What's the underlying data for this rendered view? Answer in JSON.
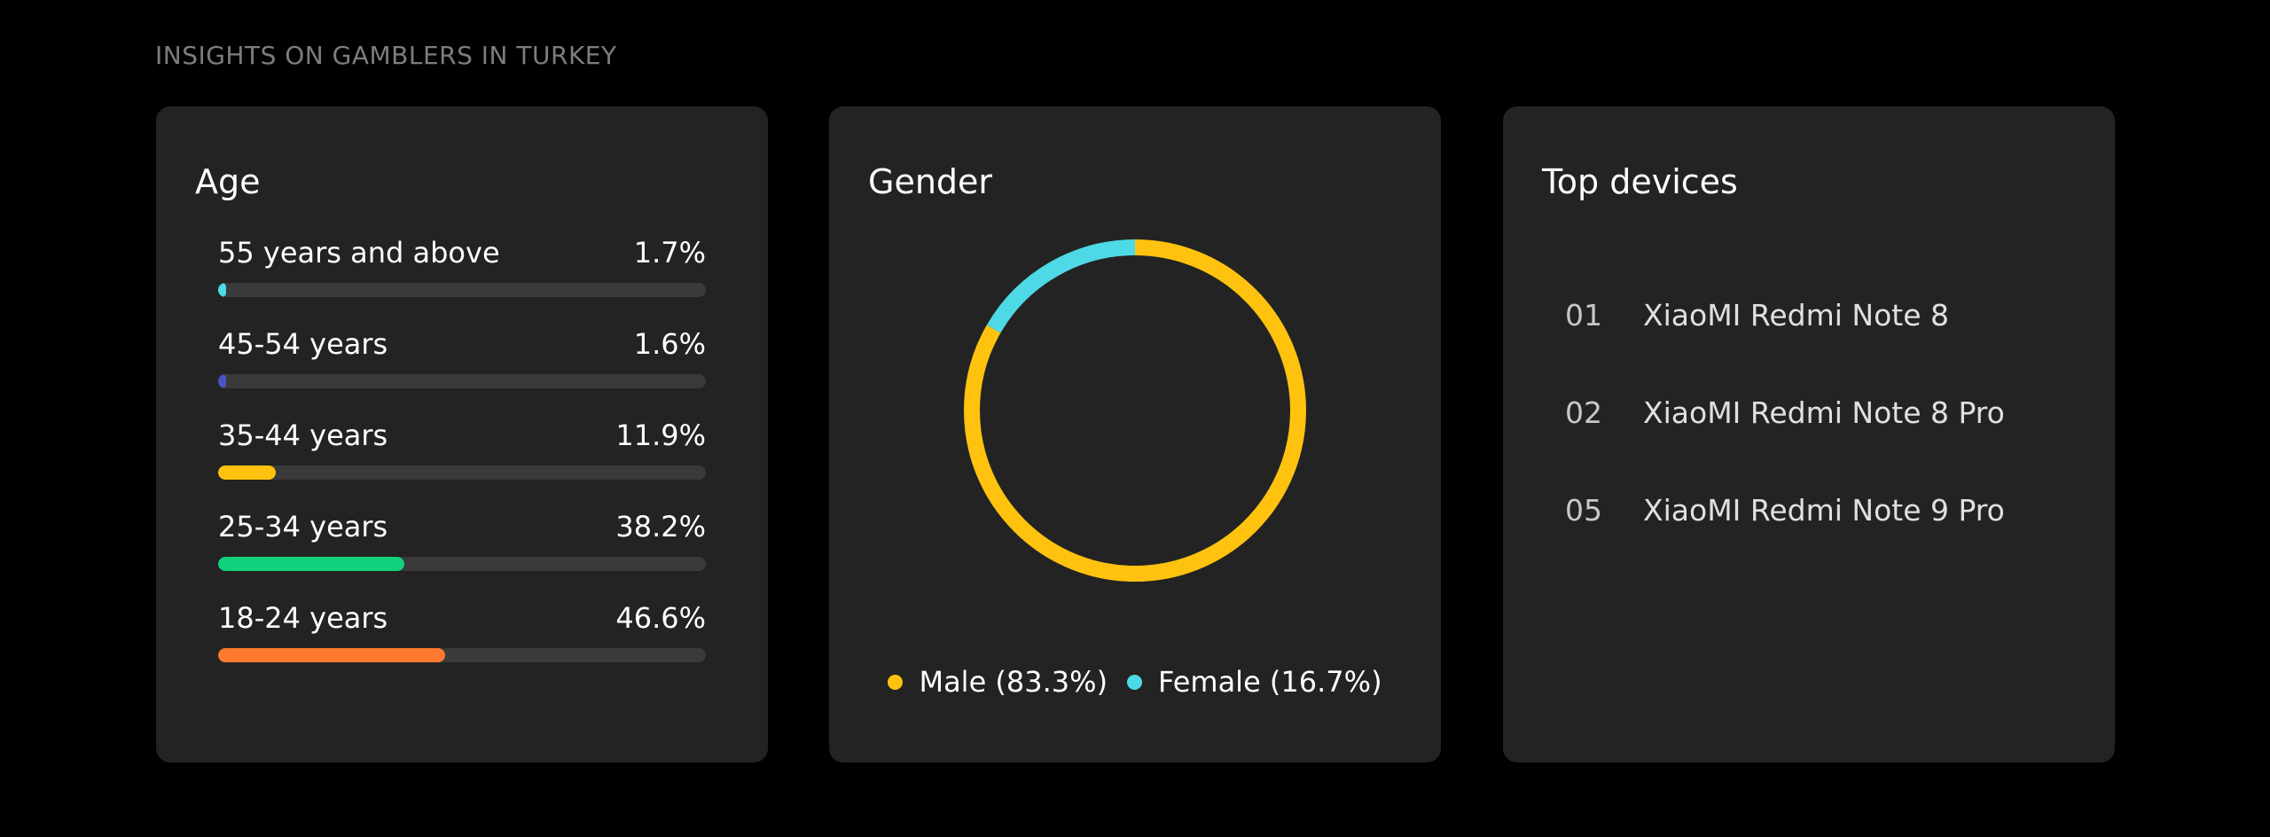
{
  "page": {
    "title": "INSIGHTS ON GAMBLERS IN TURKEY"
  },
  "age": {
    "title": "Age",
    "items": [
      {
        "label": "55 years and above",
        "value_text": "1.7%",
        "value": 1.7,
        "color": "#4dd9e6"
      },
      {
        "label": "45-54 years",
        "value_text": "1.6%",
        "value": 1.6,
        "color": "#4a52c8"
      },
      {
        "label": "35-44 years",
        "value_text": "11.9%",
        "value": 11.9,
        "color": "#ffc30f"
      },
      {
        "label": "25-34 years",
        "value_text": "38.2%",
        "value": 38.2,
        "color": "#12d17c"
      },
      {
        "label": "18-24 years",
        "value_text": "46.6%",
        "value": 46.6,
        "color": "#ff7a30"
      }
    ]
  },
  "gender": {
    "title": "Gender",
    "segments": [
      {
        "label": "Male (83.3%)",
        "value": 83.3,
        "color": "#ffc30f"
      },
      {
        "label": "Female (16.7%)",
        "value": 16.7,
        "color": "#4dd9e6"
      }
    ]
  },
  "devices": {
    "title": "Top devices",
    "items": [
      {
        "rank": "01",
        "name": "XiaoMI Redmi Note 8"
      },
      {
        "rank": "02",
        "name": "XiaoMI Redmi Note 8 Pro"
      },
      {
        "rank": "05",
        "name": "XiaoMI Redmi Note 9 Pro"
      }
    ]
  },
  "colors": {
    "background": "#000000",
    "card": "#232323",
    "track": "#3a3a3a"
  }
}
